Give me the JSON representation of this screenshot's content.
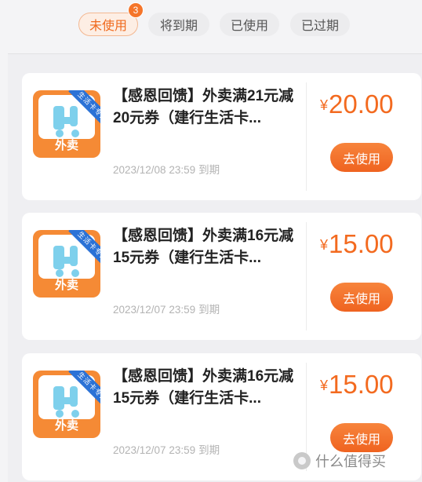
{
  "tabs": [
    {
      "label": "未使用",
      "active": true,
      "badge": "3"
    },
    {
      "label": "将到期",
      "active": false
    },
    {
      "label": "已使用",
      "active": false
    },
    {
      "label": "已过期",
      "active": false
    }
  ],
  "coupons": [
    {
      "logo_ribbon": "生活卡专属",
      "logo_label": "外卖",
      "title": "【感恩回馈】外卖满21元减20元券（建行生活卡...",
      "currency": "¥",
      "amount": "20.00",
      "expiry_date": "2023/12/08 23:59",
      "expiry_suffix": "到期",
      "button_label": "去使用"
    },
    {
      "logo_ribbon": "生活卡专属",
      "logo_label": "外卖",
      "title": "【感恩回馈】外卖满16元减15元券（建行生活卡...",
      "currency": "¥",
      "amount": "15.00",
      "expiry_date": "2023/12/07 23:59",
      "expiry_suffix": "到期",
      "button_label": "去使用"
    },
    {
      "logo_ribbon": "生活卡专属",
      "logo_label": "外卖",
      "title": "【感恩回馈】外卖满16元减15元券（建行生活卡...",
      "currency": "¥",
      "amount": "15.00",
      "expiry_date": "2023/12/07 23:59",
      "expiry_suffix": "到期",
      "button_label": "去使用"
    }
  ],
  "watermark": {
    "text": "什么值得买",
    "icon": "smzdm-logo-icon"
  },
  "colors": {
    "accent": "#f36a1f",
    "tab_active_bg": "#fdeee4",
    "logo_bg": "#f58a35",
    "ribbon": "#2b72d6"
  }
}
